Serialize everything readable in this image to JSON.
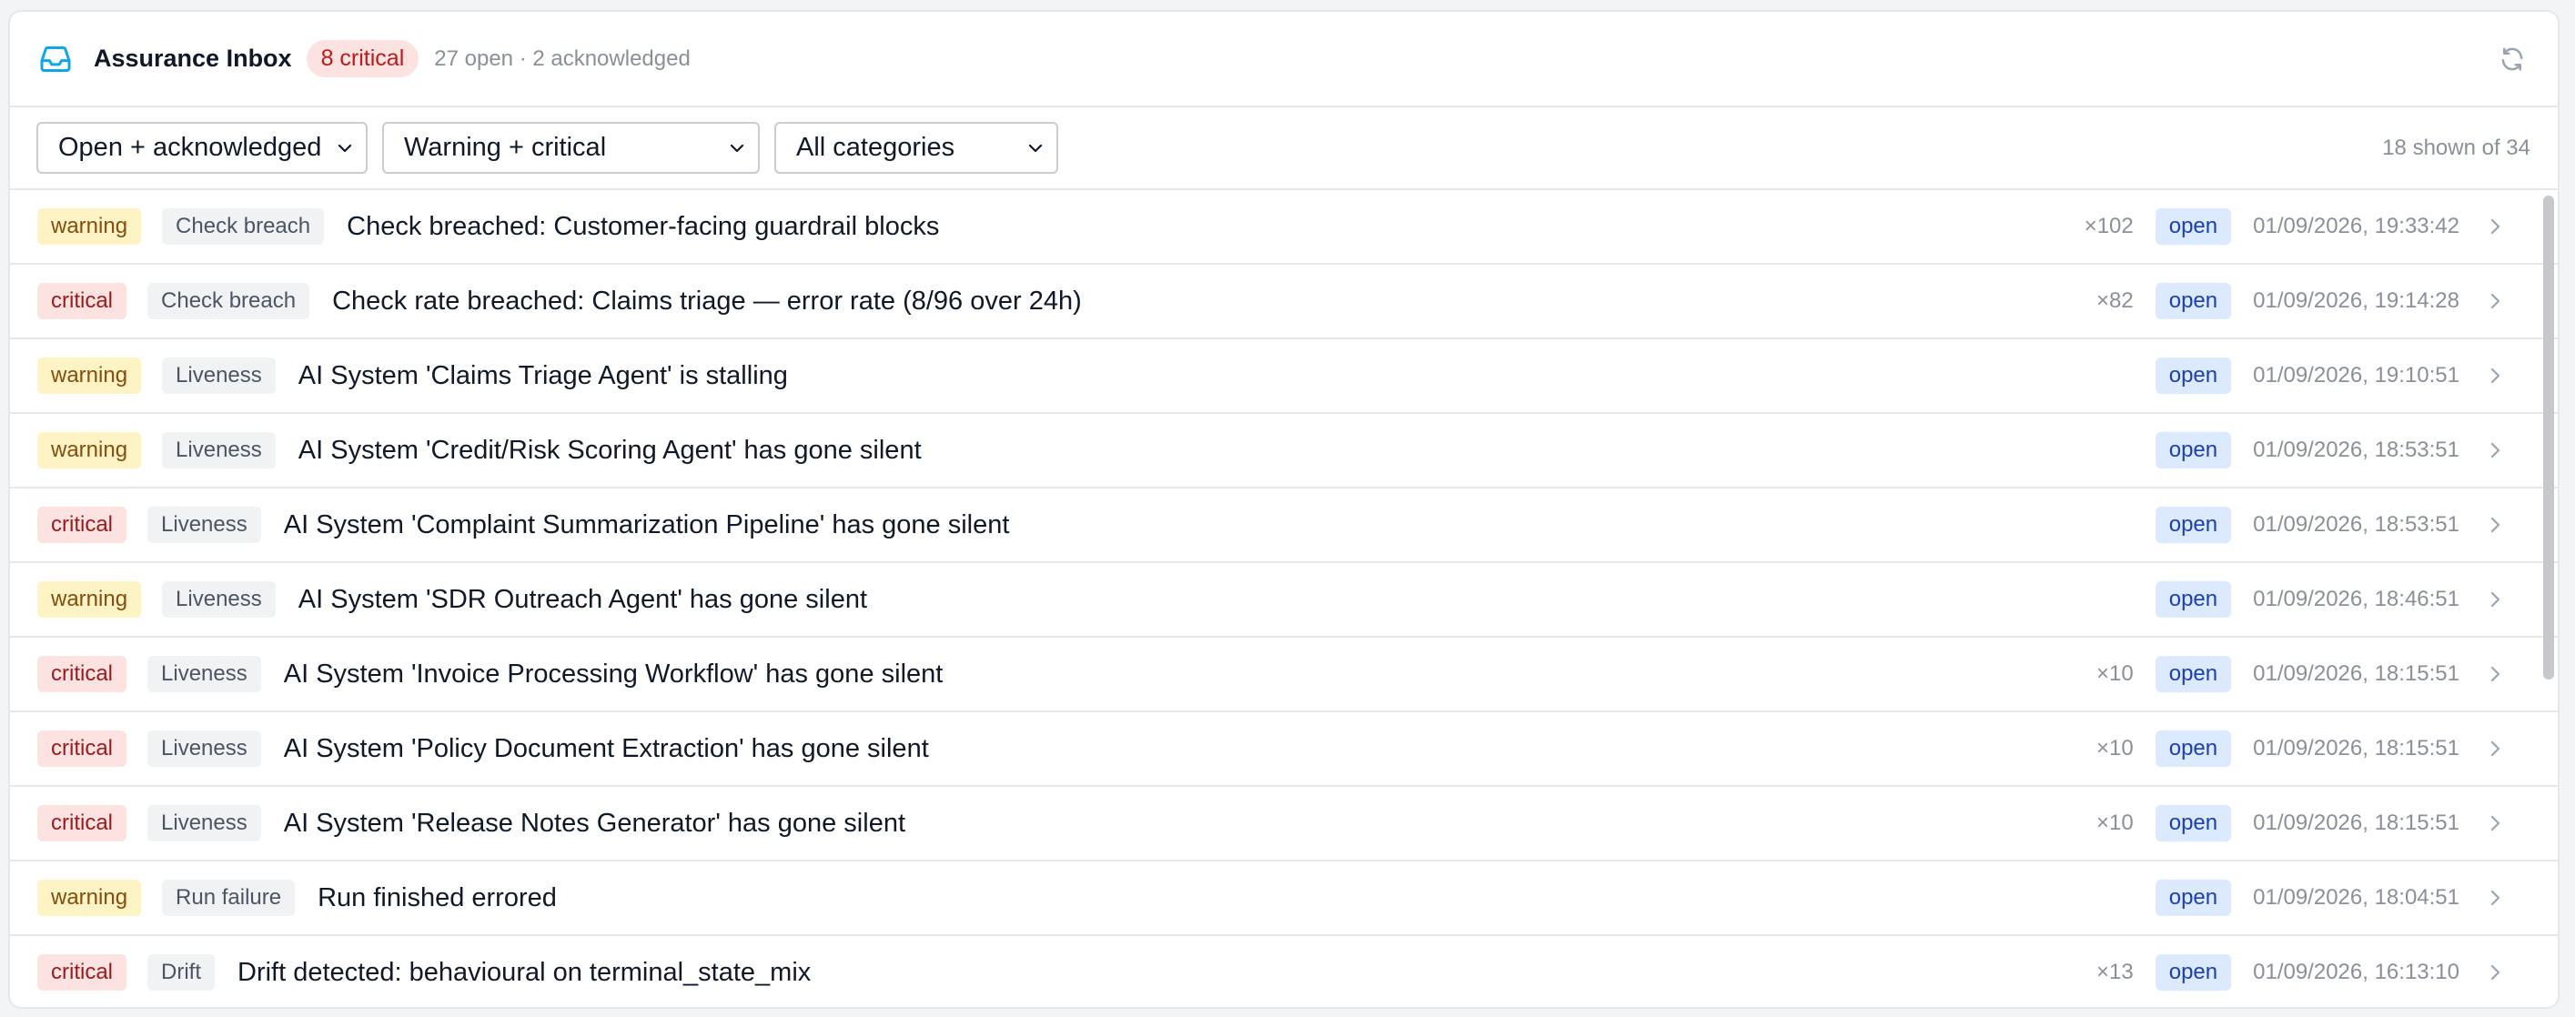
{
  "header": {
    "title": "Assurance Inbox",
    "critical_badge": "8 critical",
    "summary": "27 open · 2 acknowledged",
    "icons": {
      "inbox": "inbox-tray-icon",
      "refresh": "refresh-icon"
    },
    "accent_color": "#0ea5e9"
  },
  "filters": {
    "status": "Open + acknowledged",
    "severity": "Warning + critical",
    "category": "All categories",
    "shown": "18 shown of 34"
  },
  "colors": {
    "warning_bg": "#fdf3c4",
    "critical_bg": "#fde2e2",
    "status_open_bg": "#dbeafe"
  },
  "alerts": [
    {
      "severity": "warning",
      "category": "Check breach",
      "message": "Check breached: Customer-facing guardrail blocks",
      "count": "×102",
      "status": "open",
      "timestamp": "01/09/2026, 19:33:42"
    },
    {
      "severity": "critical",
      "category": "Check breach",
      "message": "Check rate breached: Claims triage — error rate (8/96 over 24h)",
      "count": "×82",
      "status": "open",
      "timestamp": "01/09/2026, 19:14:28"
    },
    {
      "severity": "warning",
      "category": "Liveness",
      "message": "AI System 'Claims Triage Agent' is stalling",
      "count": "",
      "status": "open",
      "timestamp": "01/09/2026, 19:10:51"
    },
    {
      "severity": "warning",
      "category": "Liveness",
      "message": "AI System 'Credit/Risk Scoring Agent' has gone silent",
      "count": "",
      "status": "open",
      "timestamp": "01/09/2026, 18:53:51"
    },
    {
      "severity": "critical",
      "category": "Liveness",
      "message": "AI System 'Complaint Summarization Pipeline' has gone silent",
      "count": "",
      "status": "open",
      "timestamp": "01/09/2026, 18:53:51"
    },
    {
      "severity": "warning",
      "category": "Liveness",
      "message": "AI System 'SDR Outreach Agent' has gone silent",
      "count": "",
      "status": "open",
      "timestamp": "01/09/2026, 18:46:51"
    },
    {
      "severity": "critical",
      "category": "Liveness",
      "message": "AI System 'Invoice Processing Workflow' has gone silent",
      "count": "×10",
      "status": "open",
      "timestamp": "01/09/2026, 18:15:51"
    },
    {
      "severity": "critical",
      "category": "Liveness",
      "message": "AI System 'Policy Document Extraction' has gone silent",
      "count": "×10",
      "status": "open",
      "timestamp": "01/09/2026, 18:15:51"
    },
    {
      "severity": "critical",
      "category": "Liveness",
      "message": "AI System 'Release Notes Generator' has gone silent",
      "count": "×10",
      "status": "open",
      "timestamp": "01/09/2026, 18:15:51"
    },
    {
      "severity": "warning",
      "category": "Run failure",
      "message": "Run finished errored",
      "count": "",
      "status": "open",
      "timestamp": "01/09/2026, 18:04:51"
    },
    {
      "severity": "critical",
      "category": "Drift",
      "message": "Drift detected: behavioural on terminal_state_mix",
      "count": "×13",
      "status": "open",
      "timestamp": "01/09/2026, 16:13:10"
    }
  ]
}
